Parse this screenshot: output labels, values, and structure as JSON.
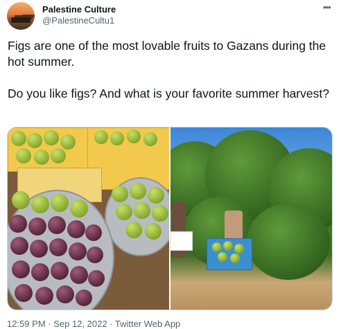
{
  "author": {
    "display_name": "Palestine Culture",
    "handle": "@PalestineCultu1",
    "avatar_icon": "avatar-icon"
  },
  "more_icon": "more-horizontal-icon",
  "tweet": {
    "paragraphs": [
      "Figs are one of the most lovable fruits to Gazans during the hot summer.",
      "Do you like figs? And what is your favorite summer harvest?"
    ]
  },
  "media": {
    "photos": [
      {
        "name": "figs-market-photo",
        "subject": "market-figs"
      },
      {
        "name": "fig-harvest-photo",
        "subject": "harvest-field"
      }
    ]
  },
  "meta": {
    "timestamp": "12:59 PM · Sep 12, 2022 · Twitter Web App"
  },
  "colors": {
    "text_primary": "#0f1419",
    "text_secondary": "#536471",
    "border": "#cfd9de"
  }
}
